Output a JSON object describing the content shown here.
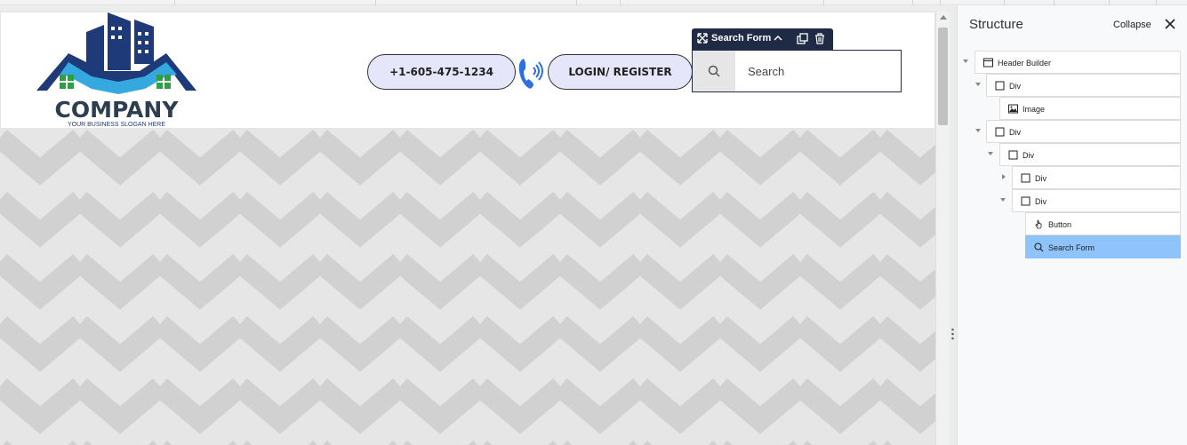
{
  "canvas": {
    "logo": {
      "name": "COMPANY",
      "slogan": "YOUR BUSINESS SLOGAN HERE"
    },
    "phone_button": "+1-605-475-1234",
    "login_button": "LOGIN/ REGISTER",
    "search_toolbar": {
      "label": "Search Form"
    },
    "search": {
      "placeholder": "Search",
      "value": ""
    }
  },
  "panel": {
    "title": "Structure",
    "collapse_label": "Collapse",
    "tree": [
      {
        "label": "Header Builder",
        "icon": "layout-icon",
        "caret": "down"
      },
      {
        "label": "Div",
        "icon": "box-icon",
        "caret": "down"
      },
      {
        "label": "Image",
        "icon": "image-icon",
        "caret": ""
      },
      {
        "label": "Div",
        "icon": "box-icon",
        "caret": "down"
      },
      {
        "label": "Div",
        "icon": "box-icon",
        "caret": "down"
      },
      {
        "label": "Div",
        "icon": "box-icon",
        "caret": "right"
      },
      {
        "label": "Div",
        "icon": "box-icon",
        "caret": "down"
      },
      {
        "label": "Button",
        "icon": "hand-pointer-icon",
        "caret": ""
      },
      {
        "label": "Search Form",
        "icon": "search-icon",
        "caret": "",
        "selected": true
      }
    ]
  },
  "colors": {
    "accent_dark": "#1f2a44",
    "pill_fill": "#e6e6fa",
    "selected_row": "#8fc3fb",
    "logo_dark_blue": "#1e3a78",
    "logo_light_blue": "#35a8e0",
    "logo_green": "#2ea043"
  }
}
